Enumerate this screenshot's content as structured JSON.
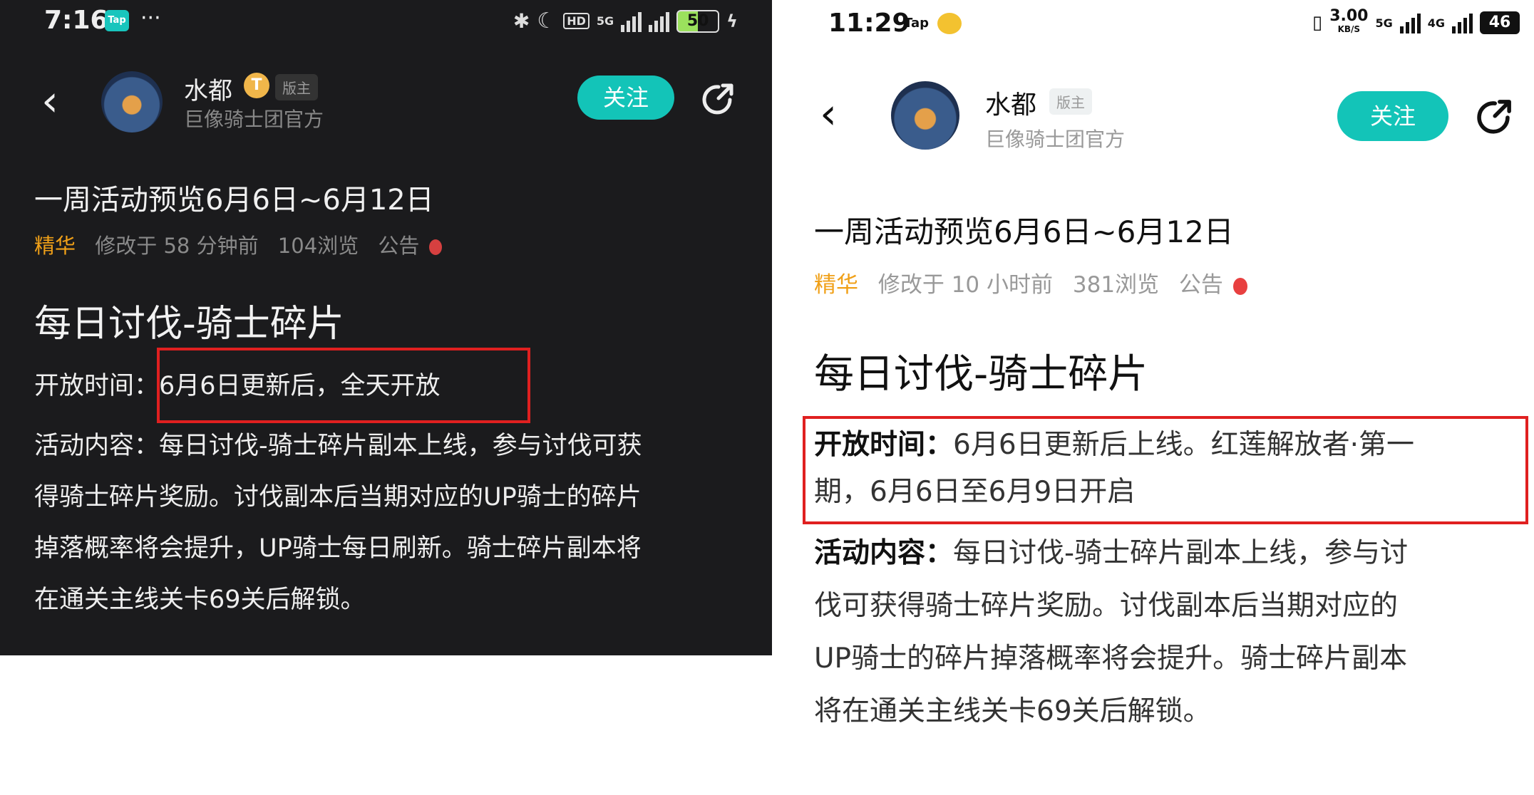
{
  "left": {
    "status": {
      "time": "7:16",
      "app_icon": "Tap",
      "battery": "50",
      "network": "5G"
    },
    "header": {
      "username": "水都",
      "level_badge": "T",
      "role_badge": "版主",
      "org": "巨像骑士团官方",
      "follow": "关注"
    },
    "post": {
      "title": "一周活动预览6月6日~6月12日",
      "tag": "精华",
      "modified": "修改于 58 分钟前",
      "views": "104浏览",
      "category": "公告",
      "heading": "每日讨伐-骑士碎片",
      "open_label": "开放时间：",
      "open_value": "6月6日更新后，全天开放",
      "content_lines": [
        "活动内容：每日讨伐-骑士碎片副本上线，参与讨伐可获",
        "得骑士碎片奖励。讨伐副本后当期对应的UP骑士的碎片",
        "掉落概率将会提升，UP骑士每日刷新。骑士碎片副本将",
        "在通关主线关卡69关后解锁。"
      ]
    }
  },
  "right": {
    "status": {
      "time": "11:29",
      "app_icon": "Tap",
      "speed": "3.00",
      "speed_unit": "KB/S",
      "network": "5G",
      "network2": "4G",
      "battery": "46"
    },
    "header": {
      "username": "水都",
      "role_badge": "版主",
      "org": "巨像骑士团官方",
      "follow": "关注"
    },
    "post": {
      "title": "一周活动预览6月6日~6月12日",
      "tag": "精华",
      "modified": "修改于 10 小时前",
      "views": "381浏览",
      "category": "公告",
      "heading": "每日讨伐-骑士碎片",
      "open_label": "开放时间：",
      "open_line1": "6月6日更新后上线。红莲解放者·第一",
      "open_line2": "期，6月6日至6月9日开启",
      "content_label": "活动内容：",
      "content_line1": "每日讨伐-骑士碎片副本上线，参与讨",
      "content_lines": [
        "伐可获得骑士碎片奖励。讨伐副本后当期对应的",
        "UP骑士的碎片掉落概率将会提升。骑士碎片副本",
        "将在通关主线关卡69关后解锁。"
      ]
    }
  },
  "colors": {
    "accent": "#13c4b8",
    "highlight": "#f0a018",
    "box": "#e02020",
    "dark_bg": "#1b1b1d"
  }
}
